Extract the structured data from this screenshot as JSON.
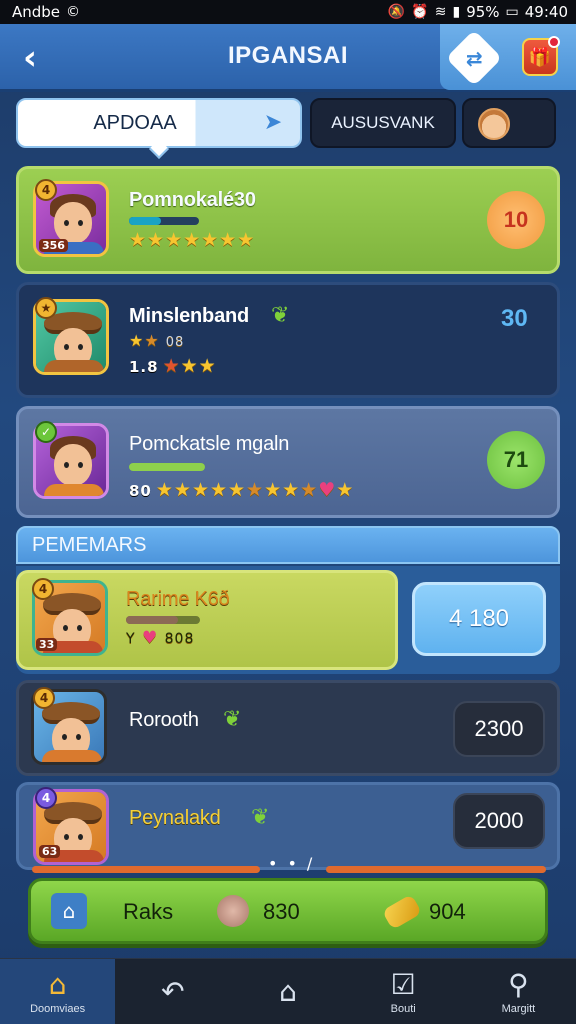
{
  "status_bar": {
    "app_label": "Andbe",
    "battery": "95%",
    "time": "49:40"
  },
  "header": {
    "title": "IPGANSAI",
    "back_icon": "chevron-left-icon",
    "share_icon": "share-icon",
    "gift_icon": "gift-icon"
  },
  "tabs": {
    "active_label": "APDOAA",
    "other_label": "AUSUSVANK"
  },
  "top_rows": [
    {
      "name": "Pomnokalé30",
      "score": "10",
      "level_badge": "4",
      "level_num": "356",
      "bar_fill": 0.45,
      "star_prefix": ""
    },
    {
      "name": "Minslenband",
      "score": "30",
      "level_badge": "",
      "prefix": "1.8",
      "extra": "08",
      "bar_fill": 0
    },
    {
      "name": "Pomckatsle mgaln",
      "score": "71",
      "level_badge": "",
      "prefix": "80",
      "bar_fill": 0.6
    }
  ],
  "section": {
    "title": "PEMEMARS"
  },
  "bottom_rows": [
    {
      "name": "Rarime K6ð",
      "score": "4 180",
      "level_badge": "4",
      "level_num": "33",
      "prefix": "Y",
      "extra": "808",
      "bar_fill": 0.7
    },
    {
      "name": "Rorooth",
      "score": "2300",
      "level_badge": "4",
      "level_num": ""
    },
    {
      "name": "Peynalakd",
      "score": "2000",
      "level_badge": "4",
      "level_num": "63"
    }
  ],
  "action_bar": {
    "label": "Raks",
    "value_1": "830",
    "value_2": "904"
  },
  "nav": {
    "items": [
      {
        "label": "Doomviaes",
        "icon": "home-icon"
      },
      {
        "label": "",
        "icon": "back-arrow-icon"
      },
      {
        "label": "",
        "icon": "house-outline-icon"
      },
      {
        "label": "Bouti",
        "icon": "checkbox-icon"
      },
      {
        "label": "Margitt",
        "icon": "person-icon"
      }
    ]
  },
  "colors": {
    "row_green": "#8bc34a",
    "row_navy": "#1f3a63",
    "row_slate": "#57709a",
    "accent_blue": "#5fb8f4",
    "score_orange": "#f6a65a",
    "score_green": "#7ccb4f"
  }
}
